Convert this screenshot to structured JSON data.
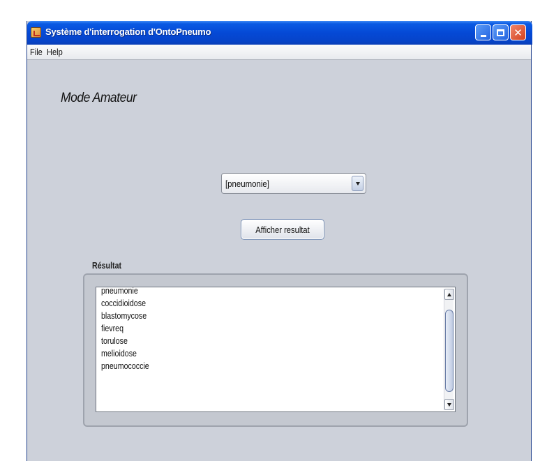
{
  "window": {
    "title": "Système d'interrogation d'OntoPneumo",
    "icon": "java-cup-icon",
    "controls": {
      "minimize": "minimize-icon",
      "maximize": "maximize-icon",
      "close": "✕"
    }
  },
  "menubar": {
    "items": [
      {
        "label": "File"
      },
      {
        "label": "Help"
      }
    ]
  },
  "main": {
    "mode_title": "Mode Amateur",
    "combo": {
      "selected": "[pneumonie]"
    },
    "show_button": {
      "label": "Afficher resultat"
    },
    "result": {
      "label": "Résultat",
      "items": [
        "pneumonie",
        "coccidioidose",
        "blastomycose",
        "fievreq",
        "torulose",
        "melioidose",
        "pneumococcie"
      ]
    }
  },
  "colors": {
    "titlebar": "#0549d6",
    "window_bg": "#cdd1da",
    "close_button": "#d2411e"
  }
}
